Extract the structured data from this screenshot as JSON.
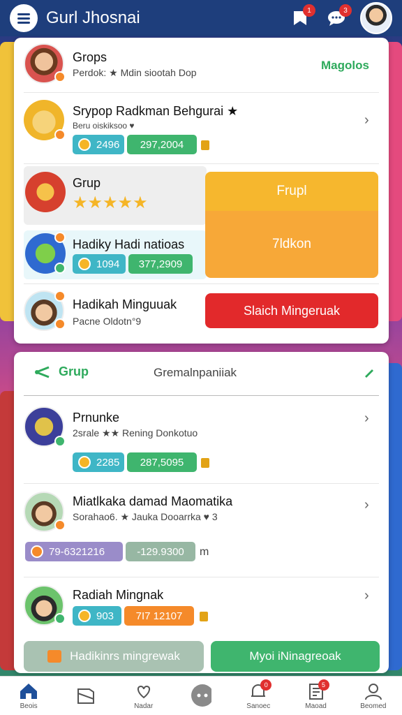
{
  "header": {
    "title": "Gurl Jhosnai",
    "badge_left": "1",
    "badge_right": "3"
  },
  "card1": {
    "row1": {
      "title": "Grops",
      "subtitle": "Perdok: ★ Mdin siootah Dop",
      "action": "Magolos"
    },
    "row2": {
      "title": "Srypop Radkman Behgurai ★",
      "subtitle": "Beru oiskiksoo ♥",
      "pill1": "2496",
      "pill2": "297,2004"
    },
    "row3": {
      "title": "Grup",
      "stars": "★★★★★"
    },
    "row4": {
      "title": "Hadiky Hadi natioas",
      "pill1": "1094",
      "pill2": "377,2909"
    },
    "row5": {
      "title": "Hadikah Minguuak",
      "subtitle": "Pacne Oldotn°9"
    },
    "btn_top": "Frupl",
    "btn_mid": "7ldkon",
    "btn_red": "Slaich Mingeruak"
  },
  "card2": {
    "tab_left": "Grup",
    "tab_right": "Gremalnpaniiak",
    "item1": {
      "title": "Prnunke",
      "subtitle": "2srale ★★ Rening Donkotuo",
      "pill1": "2285",
      "pill2": "287,5095"
    },
    "item2": {
      "title": "Miatlkaka damad Maomatika",
      "subtitle": "Sorahao6. ★ Jauka Dooarrka ♥ 3",
      "pill1": "79-6321216",
      "pill2": "-129.9300",
      "unit": "m"
    },
    "item3": {
      "title": "Radiah Mingnak",
      "pill1": "903",
      "pill2": "7I7 12107"
    },
    "btn_left": "Hadikinrs mingrewak",
    "btn_right": "Myoi iNinagreoak"
  },
  "nav": {
    "items": [
      {
        "label": "Beois",
        "icon": "home-icon"
      },
      {
        "label": "",
        "icon": "book-icon"
      },
      {
        "label": "Nadar",
        "icon": "heart-hand-icon"
      },
      {
        "label": "",
        "icon": "more-icon"
      },
      {
        "label": "Sanoec",
        "icon": "bell-icon",
        "badge": "0"
      },
      {
        "label": "Maoad",
        "icon": "notebook-icon",
        "badge": "5"
      },
      {
        "label": "Beomed",
        "icon": "profile-icon"
      }
    ]
  },
  "colors": {
    "header": "#1e3e7c",
    "teal": "#3fb6c6",
    "green": "#3fb56e",
    "orange": "#f58a2a",
    "yellow": "#f6b72e",
    "red": "#e2292b",
    "purple": "#9a8cc9"
  }
}
